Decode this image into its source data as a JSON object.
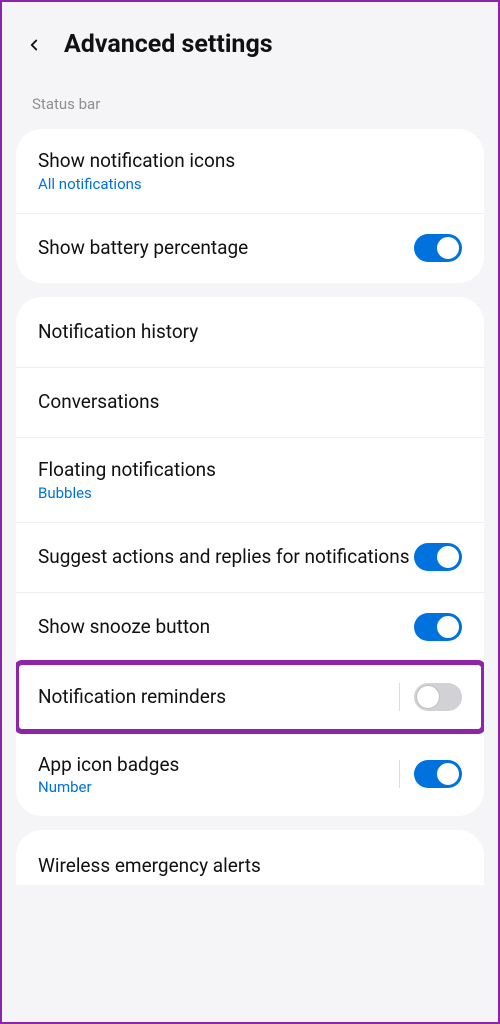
{
  "header": {
    "title": "Advanced settings"
  },
  "section1": {
    "label": "Status bar",
    "items": [
      {
        "title": "Show notification icons",
        "sub": "All notifications"
      },
      {
        "title": "Show battery percentage"
      }
    ]
  },
  "section2": {
    "items": [
      {
        "title": "Notification history"
      },
      {
        "title": "Conversations"
      },
      {
        "title": "Floating notifications",
        "sub": "Bubbles"
      },
      {
        "title": "Suggest actions and replies for notifications"
      },
      {
        "title": "Show snooze button"
      },
      {
        "title": "Notification reminders"
      },
      {
        "title": "App icon badges",
        "sub": "Number"
      }
    ]
  },
  "peek": {
    "title": "Wireless emergency alerts"
  }
}
